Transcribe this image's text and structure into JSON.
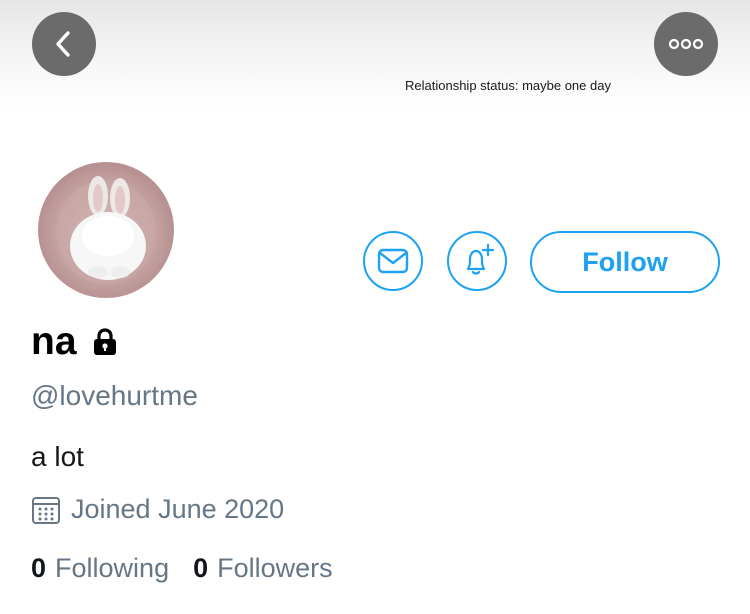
{
  "banner": {
    "text": "Relationship status: maybe one day"
  },
  "nav": {
    "back_icon": "chevron-left-icon",
    "more_icon": "more-horizontal-icon"
  },
  "profile": {
    "display_name": "na",
    "protected_icon": "lock-icon",
    "handle": "@lovehurtme",
    "bio": "a lot",
    "joined": "Joined June 2020",
    "following_count": "0",
    "following_label": "Following",
    "followers_count": "0",
    "followers_label": "Followers"
  },
  "actions": {
    "message_icon": "mail-icon",
    "notify_icon": "bell-plus-icon",
    "follow_label": "Follow"
  },
  "colors": {
    "accent": "#1da1f2",
    "secondary_text": "#657786",
    "nav_button_bg": "#6b6b6b"
  }
}
